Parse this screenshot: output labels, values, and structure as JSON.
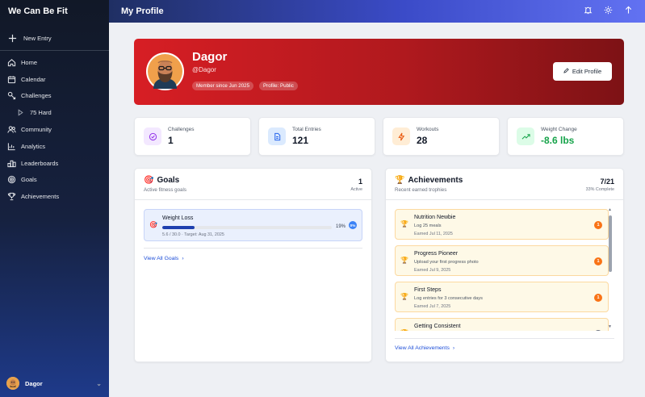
{
  "brand": "We Can Be Fit",
  "sidebar": {
    "new_entry": "New Entry",
    "items": [
      {
        "label": "Home",
        "icon": "home-icon"
      },
      {
        "label": "Calendar",
        "icon": "calendar-icon"
      },
      {
        "label": "Challenges",
        "icon": "challenges-icon"
      },
      {
        "label": "75 Hard",
        "icon": "play-icon"
      },
      {
        "label": "Community",
        "icon": "users-icon"
      },
      {
        "label": "Analytics",
        "icon": "chart-icon"
      },
      {
        "label": "Leaderboards",
        "icon": "leaderboard-icon"
      },
      {
        "label": "Goals",
        "icon": "target-icon"
      },
      {
        "label": "Achievements",
        "icon": "trophy-icon"
      }
    ],
    "user_name": "Dagor"
  },
  "header": {
    "title": "My Profile"
  },
  "profile": {
    "name": "Dagor",
    "handle": "@Dagor",
    "member_since": "Member since Jun 2025",
    "visibility": "Profile: Public",
    "edit_label": "Edit Profile"
  },
  "stats": [
    {
      "label": "Challenges",
      "value": "1",
      "color": "#9333ea"
    },
    {
      "label": "Total Entries",
      "value": "121",
      "color": "#2563eb"
    },
    {
      "label": "Workouts",
      "value": "28",
      "color": "#ea580c"
    },
    {
      "label": "Weight Change",
      "value": "-8.6 lbs",
      "color": "#16a34a"
    }
  ],
  "goals": {
    "title": "Goals",
    "subtitle": "Active fitness goals",
    "count": "1",
    "count_label": "Active",
    "items": [
      {
        "name": "Weight Loss",
        "percent": "19%",
        "progress": 0.19,
        "meta": "5.6 / 30.0 · Target: Aug 31, 2025",
        "circle": "0%"
      }
    ],
    "view_all": "View All Goals"
  },
  "achievements": {
    "title": "Achievements",
    "subtitle": "Recent earned trophies",
    "count": "7/21",
    "count_label": "33% Complete",
    "items": [
      {
        "name": "Nutrition Newbie",
        "desc": "Log 25 meals",
        "date": "Earned Jul 11, 2025",
        "badge": "1"
      },
      {
        "name": "Progress Pioneer",
        "desc": "Upload your first progress photo",
        "date": "Earned Jul 9, 2025",
        "badge": "1"
      },
      {
        "name": "First Steps",
        "desc": "Log entries for 3 consecutive days",
        "date": "Earned Jul 7, 2025",
        "badge": "1"
      },
      {
        "name": "Getting Consistent",
        "desc": "",
        "date": "",
        "badge": ""
      }
    ],
    "view_all": "View All Achievements"
  }
}
